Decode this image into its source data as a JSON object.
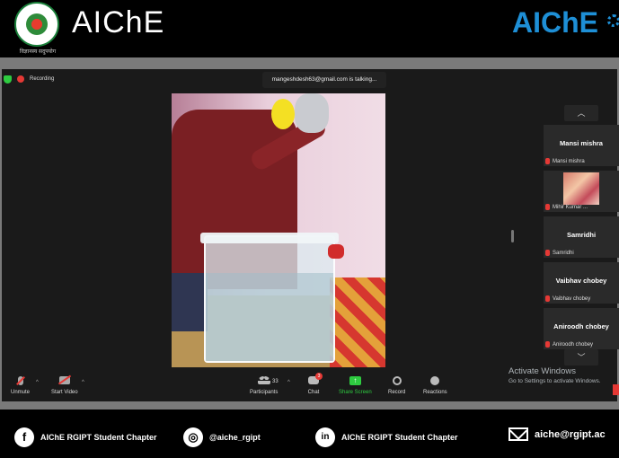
{
  "header": {
    "brand_left": "AIChE",
    "brand_right": "AIChE",
    "seal_caption": "विज्ञानस्य सदुपयोग"
  },
  "meeting": {
    "recording_label": "Recording",
    "talking_indicator": "mangeshdesh63@gmail.com is talking...",
    "participants": [
      {
        "name": "Mansi mishra",
        "tag": "Mansi mishra",
        "has_video": false
      },
      {
        "name": "",
        "tag": "Mihir Kumar ...",
        "has_video": true
      },
      {
        "name": "Samridhi",
        "tag": "Samridhi",
        "has_video": false
      },
      {
        "name": "Vaibhav chobey",
        "tag": "Vaibhav chobey",
        "has_video": false
      },
      {
        "name": "Aniroodh chobey",
        "tag": "Aniroodh chobey",
        "has_video": false
      }
    ]
  },
  "toolbar": {
    "unmute": "Unmute",
    "start_video": "Start Video",
    "participants": "Participants",
    "participant_count": "33",
    "chat": "Chat",
    "chat_badge": "3",
    "share_screen": "Share Screen",
    "record": "Record",
    "reactions": "Reactions",
    "share_color": "#2ecc40"
  },
  "watermark": {
    "title": "Activate Windows",
    "subtitle": "Go to Settings to activate Windows."
  },
  "footer": {
    "facebook_icon": "f",
    "facebook": "AIChE RGIPT Student Chapter",
    "instagram_icon": "◎",
    "instagram": "@aiche_rgipt",
    "linkedin_icon": "in",
    "linkedin": "AIChE RGIPT Student Chapter",
    "email": "aiche@rgipt.ac"
  }
}
